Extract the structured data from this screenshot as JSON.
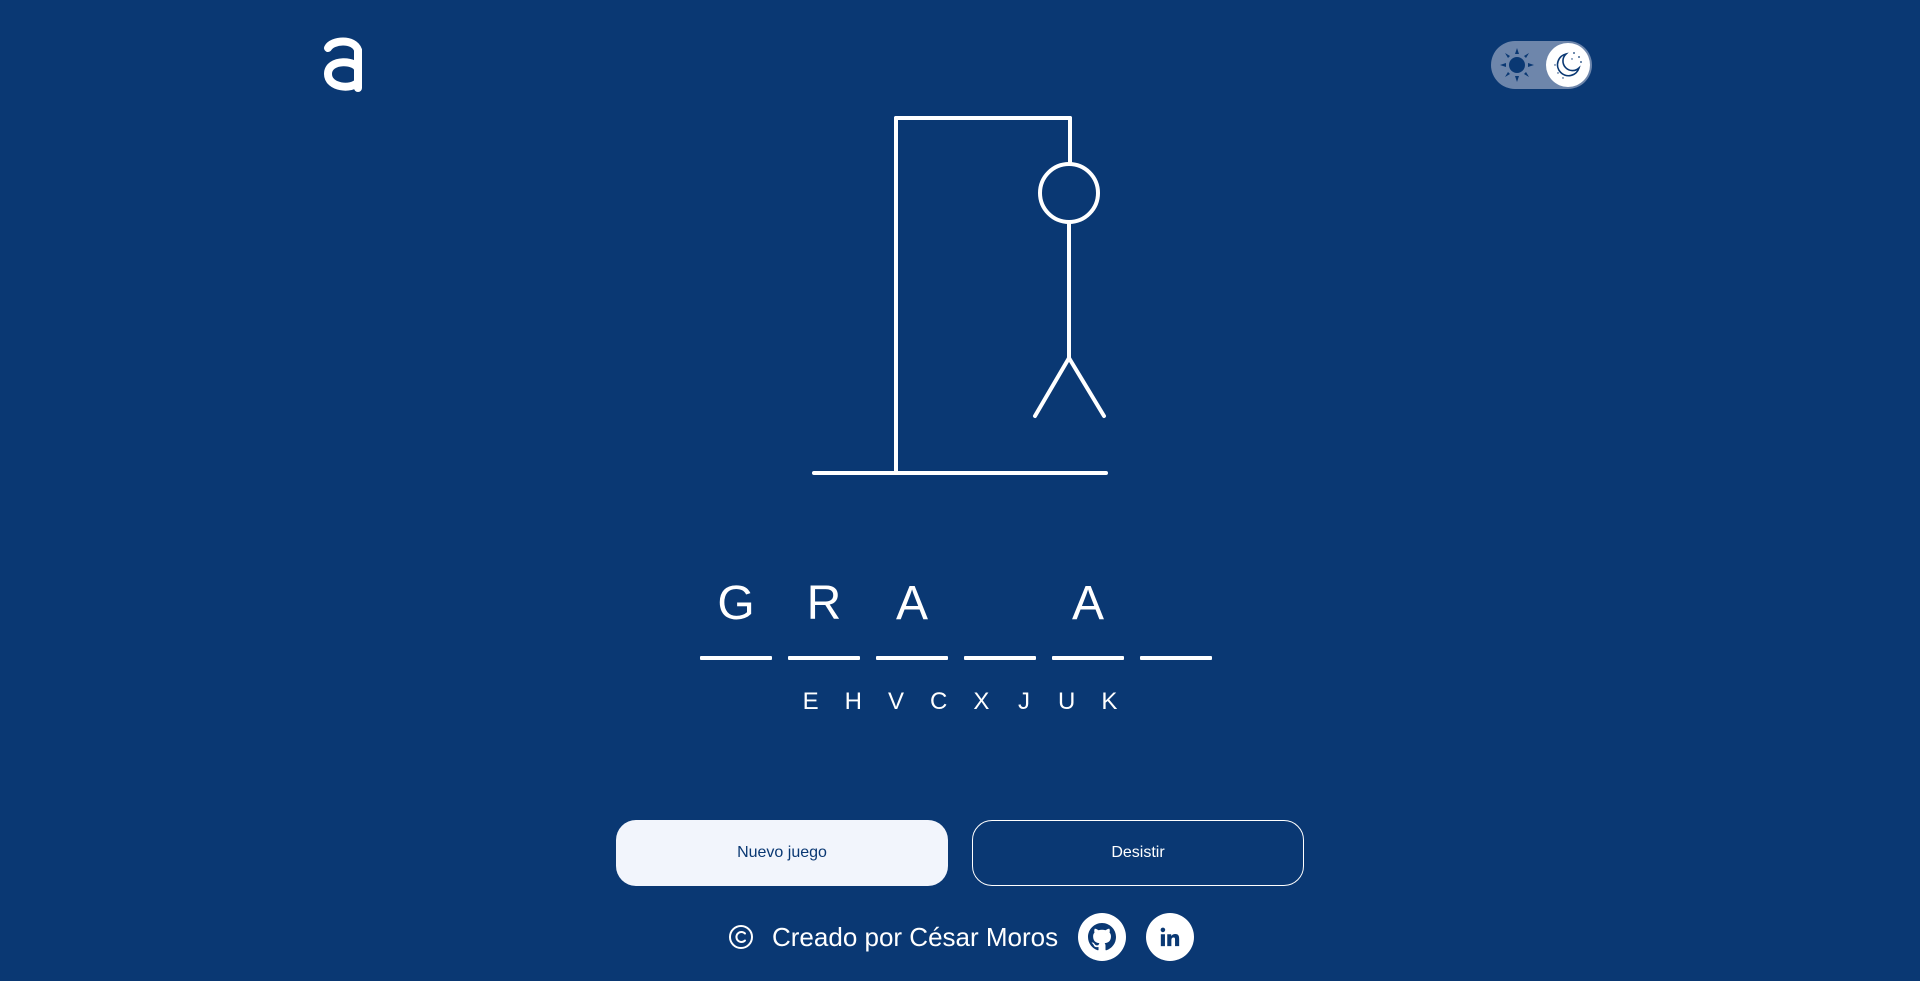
{
  "brand": {
    "logo_icon": "letter-a-logo-icon"
  },
  "theme_toggle": {
    "sun_icon": "sun-icon",
    "moon_icon": "moon-icon",
    "active": "dark"
  },
  "game": {
    "word_slots": [
      "G",
      "R",
      "A",
      "",
      "A",
      ""
    ],
    "wrong_letters": [
      "E",
      "H",
      "V",
      "C",
      "X",
      "J",
      "U",
      "K"
    ]
  },
  "actions": {
    "new_game_label": "Nuevo juego",
    "give_up_label": "Desistir"
  },
  "footer": {
    "copyright_icon": "copyright-icon",
    "credit": "Creado por César Moros",
    "github_icon": "github-icon",
    "linkedin_icon": "linkedin-icon"
  },
  "colors": {
    "background": "#0a3873",
    "primary_button_bg": "#f2f5fc",
    "foreground": "#ffffff",
    "toggle_track": "#6e86ab"
  }
}
